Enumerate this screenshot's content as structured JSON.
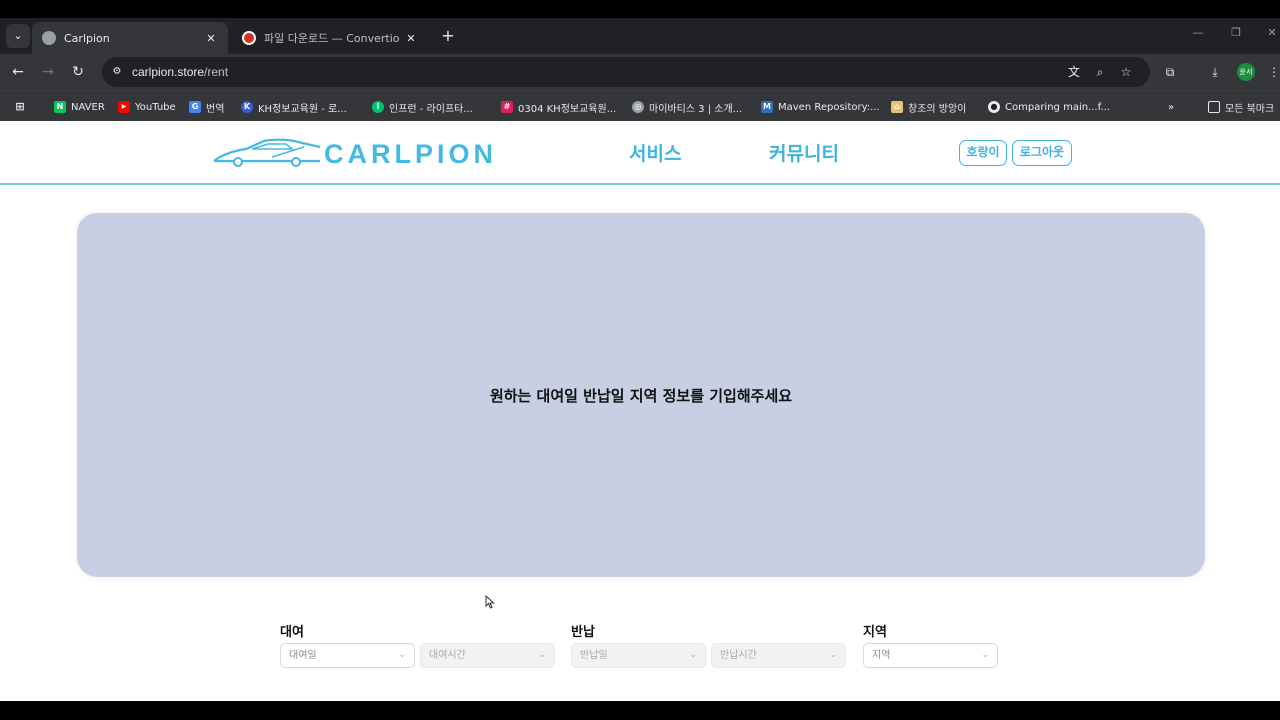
{
  "browser": {
    "tabs": [
      {
        "title": "Carlpion",
        "active": true
      },
      {
        "title": "파일 다운로드 — Convertio",
        "active": false
      }
    ],
    "url": {
      "host": "carlpion.store",
      "path": "/rent"
    },
    "bookmarks": [
      {
        "label": "NAVER",
        "color": "#03c75a",
        "icon": "N"
      },
      {
        "label": "YouTube",
        "color": "#ff0000",
        "icon": "▶"
      },
      {
        "label": "번역",
        "color": "#4285f4",
        "icon": "G"
      },
      {
        "label": "KH정보교육원 - 로...",
        "color": "#3b5bdb",
        "icon": "K"
      },
      {
        "label": "인프런 - 라이프타...",
        "color": "#00c471",
        "icon": "i"
      },
      {
        "label": "0304 KH정보교육원...",
        "color": "#e01e5a",
        "icon": "#"
      },
      {
        "label": "마이바티스 3 | 소개...",
        "color": "#9aa0a6",
        "icon": "◎"
      },
      {
        "label": "Maven Repository:...",
        "color": "#2f6fbf",
        "icon": "M"
      },
      {
        "label": "창조의 방앙이",
        "color": "#e6c27a",
        "icon": "⌂"
      },
      {
        "label": "Comparing main...f...",
        "color": "#e8eaed",
        "icon": "●"
      }
    ],
    "bookmarks_folder": "모든 북마크",
    "profile_initial": "윤서"
  },
  "site": {
    "logo_text": "CARLPION",
    "nav": [
      "서비스",
      "커뮤니티"
    ],
    "user_button": "호랑이",
    "logout_button": "로그아웃",
    "colors": {
      "accent": "#42b2e0",
      "banner": "#c7d0e3"
    }
  },
  "banner": {
    "message": "원하는 대여일 반납일 지역 정보를 기입해주세요"
  },
  "form": {
    "rent": {
      "label": "대여",
      "date_placeholder": "대여일",
      "time_placeholder": "대여시간"
    },
    "return": {
      "label": "반납",
      "date_placeholder": "반납일",
      "time_placeholder": "반납시간"
    },
    "region": {
      "label": "지역",
      "placeholder": "지역"
    }
  }
}
